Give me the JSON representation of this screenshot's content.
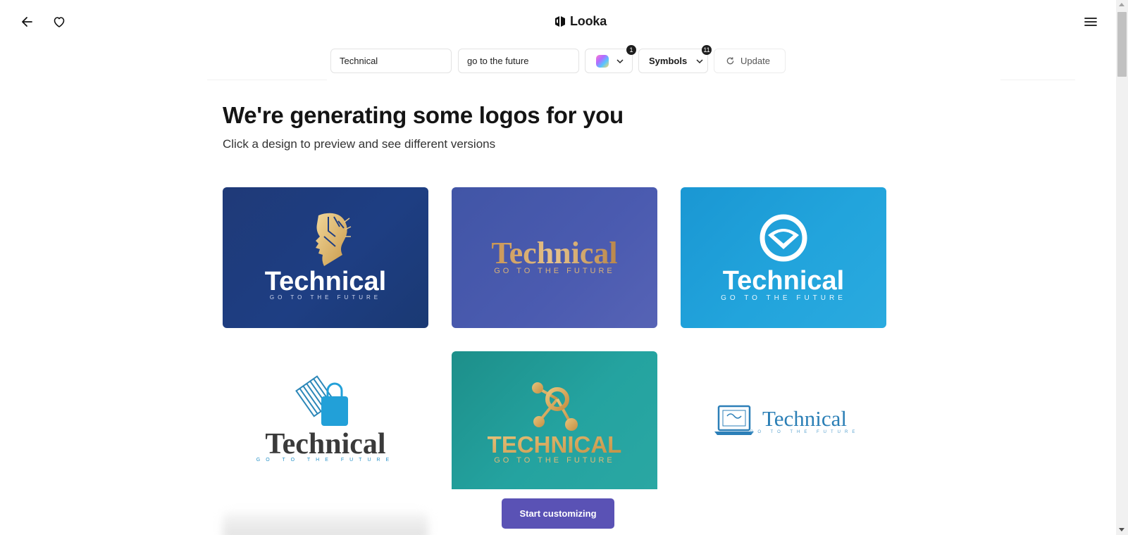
{
  "header": {
    "brand": "Looka",
    "back_icon": "arrow-left-icon",
    "favorite_icon": "heart-icon",
    "menu_icon": "hamburger-menu-icon"
  },
  "filters": {
    "industry_value": "Technical",
    "slogan_value": "go to the future",
    "color_badge": "1",
    "symbols_label": "Symbols",
    "symbols_badge": "11",
    "update_label": "Update"
  },
  "main": {
    "title": "We're generating some logos for you",
    "subtitle": "Click a design to preview and see different versions",
    "cta_label": "Start customizing"
  },
  "logos": [
    {
      "name": "Technical",
      "tagline": "GO TO THE FUTURE",
      "symbol": "circuit-head-icon",
      "background": "#1e3e83"
    },
    {
      "name": "Technical",
      "tagline": "GO TO THE FUTURE",
      "symbol": "none",
      "background": "#4b5bb0"
    },
    {
      "name": "Technical",
      "tagline": "GO TO THE FUTURE",
      "symbol": "heart-ribbon-icon",
      "background": "#22a4dc"
    },
    {
      "name": "Technical",
      "tagline": "GO TO THE FUTURE",
      "symbol": "shopping-bag-icon",
      "background": "#ffffff"
    },
    {
      "name": "TECHNICAL",
      "tagline": "GO TO THE FUTURE",
      "symbol": "molecule-icon",
      "background": "#24a3a0"
    },
    {
      "name": "Technical",
      "tagline": "GO TO THE FUTURE",
      "symbol": "laptop-icon",
      "background": "#ffffff"
    }
  ],
  "colors": {
    "accent": "#5a52b5",
    "gold": "#d8b36a"
  }
}
